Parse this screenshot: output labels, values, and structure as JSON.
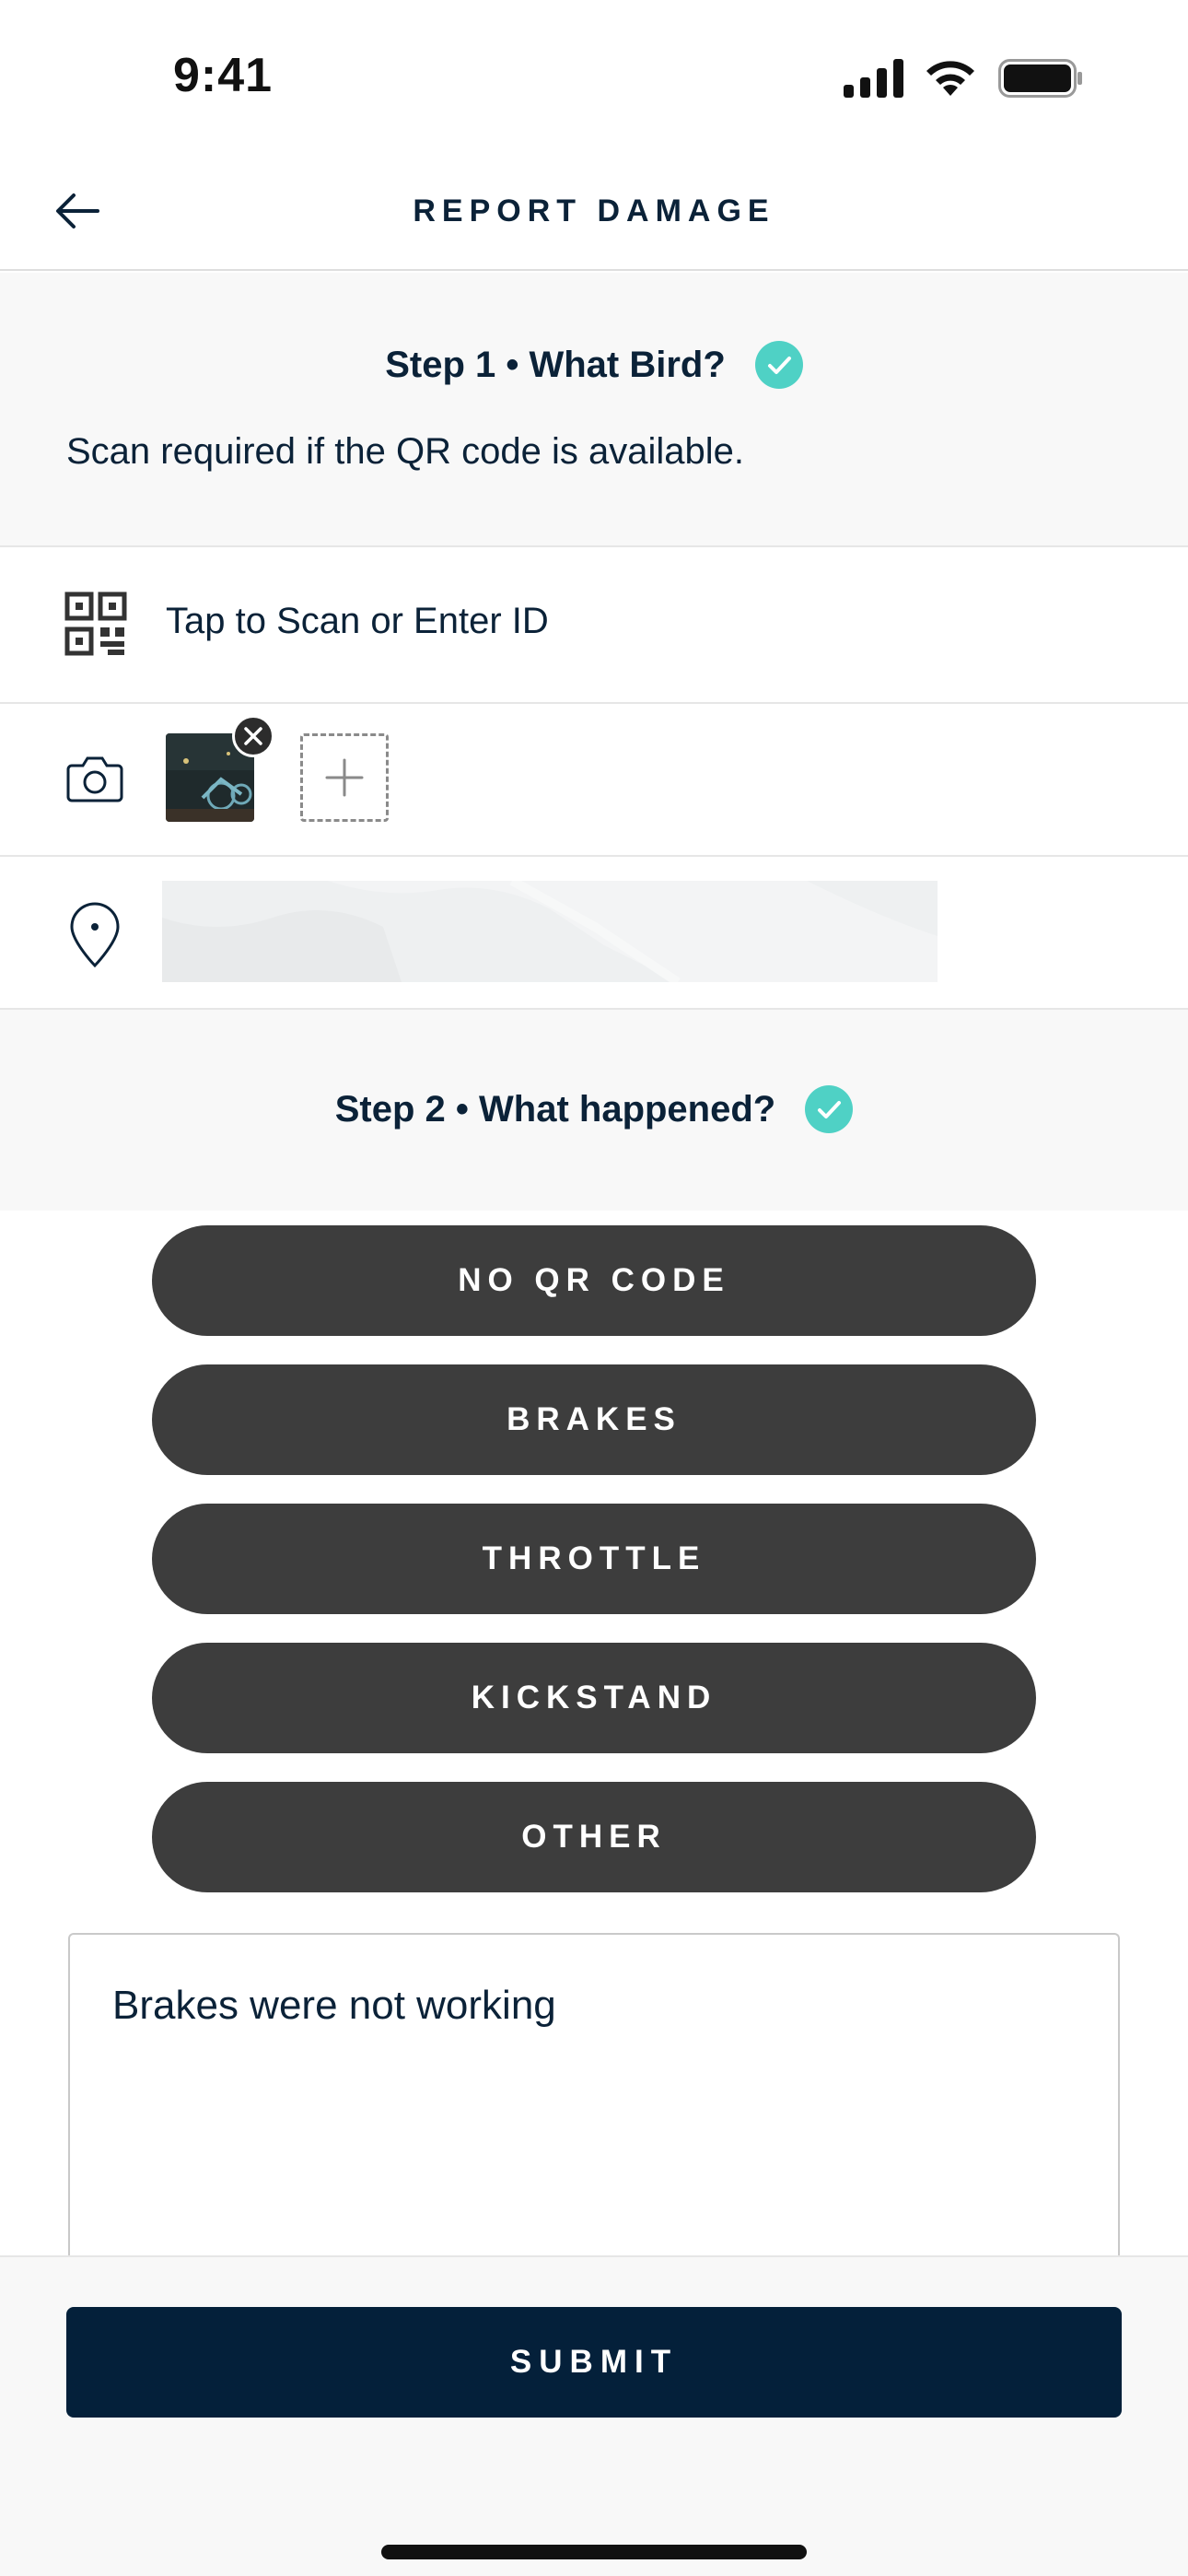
{
  "status_bar": {
    "time": "9:41"
  },
  "header": {
    "title": "REPORT DAMAGE",
    "back_icon": "arrow-left-icon"
  },
  "step1": {
    "title": "Step 1 • What Bird?",
    "subtitle": "Scan required if the QR code is available.",
    "completed": true
  },
  "scan": {
    "label": "Tap to Scan or Enter ID",
    "icon": "qr-code-icon"
  },
  "photos": {
    "icon": "camera-icon",
    "count": 1
  },
  "location": {
    "icon": "map-pin-icon"
  },
  "step2": {
    "title": "Step 2 • What happened?",
    "completed": true
  },
  "options": [
    {
      "label": "NO QR CODE"
    },
    {
      "label": "BRAKES"
    },
    {
      "label": "THROTTLE"
    },
    {
      "label": "KICKSTAND"
    },
    {
      "label": "OTHER"
    }
  ],
  "notes": {
    "value": "Brakes were not working"
  },
  "submit": {
    "label": "SUBMIT"
  },
  "colors": {
    "accent_check": "#4fd1c5",
    "primary_dark": "#04203a",
    "option_bg": "#3d3d3d"
  }
}
